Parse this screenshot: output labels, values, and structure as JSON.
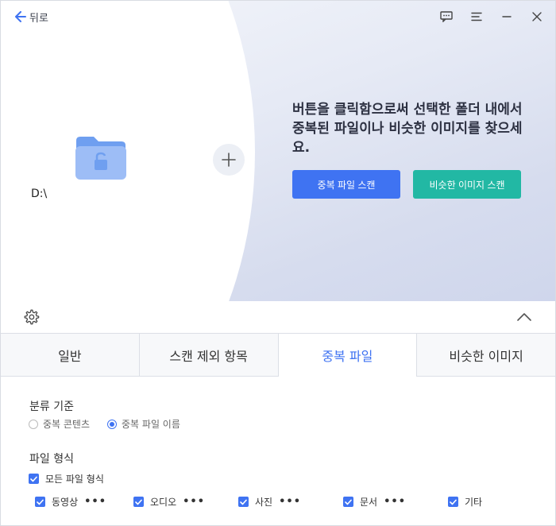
{
  "header": {
    "back_label": "뒤로"
  },
  "hero": {
    "drive_label": "D:\\",
    "message": "버튼을 클릭함으로써 선택한 폴더 내에서 중복된 파일이나 비슷한 이미지를 찾으세요.",
    "dup_scan_label": "중복 파일 스캔",
    "sim_scan_label": "비슷한 이미지 스캔"
  },
  "tabs": [
    {
      "label": "일반"
    },
    {
      "label": "스캔 제외 항목"
    },
    {
      "label": "중복 파일"
    },
    {
      "label": "비슷한 이미지"
    }
  ],
  "options": {
    "classification_title": "분류 기준",
    "radio_content": "중복 콘텐츠",
    "radio_name": "중복 파일 이름",
    "file_type_title": "파일 형식",
    "all_types": "모든 파일 형식",
    "types": [
      {
        "label": "동영상",
        "more": "•••"
      },
      {
        "label": "오디오",
        "more": "•••"
      },
      {
        "label": "사진",
        "more": "•••"
      },
      {
        "label": "문서",
        "more": "•••"
      },
      {
        "label": "기타"
      }
    ]
  },
  "colors": {
    "primary": "#3f73f2",
    "teal": "#22b8a4",
    "folder": "#8fb3f5"
  }
}
